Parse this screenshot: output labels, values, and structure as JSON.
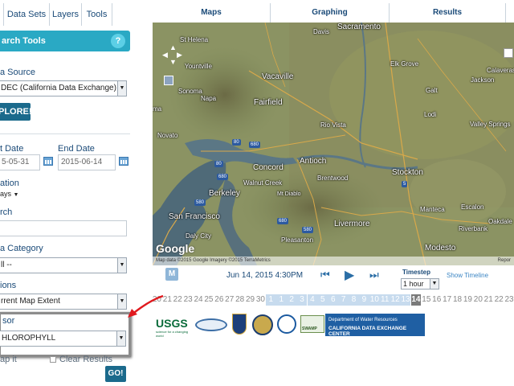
{
  "left_tabs": [
    "Data Sets",
    "Layers",
    "Tools"
  ],
  "search_header": {
    "title": "arch Tools",
    "help": "?"
  },
  "data_source": {
    "label": "a Source",
    "value": "DEC (California Data Exchange)"
  },
  "explore_button": "PLORE!",
  "dates": {
    "start_label": "t Date",
    "start_value": "5-05-31",
    "end_label": "End Date",
    "end_value": "2015-06-14"
  },
  "duration": {
    "label": "ation",
    "value": "ays"
  },
  "search": {
    "label": "rch",
    "value": ""
  },
  "data_category": {
    "label": "a Category",
    "value": "ll --"
  },
  "locations": {
    "label": "ions",
    "value": "rrent Map Extent"
  },
  "sensor": {
    "label": "sor",
    "value": "HLOROPHYLL"
  },
  "bottom_options": {
    "map_it": "ap it",
    "clear_results": "Clear Results"
  },
  "go_button": "GO!",
  "top_tabs": [
    "Maps",
    "Graphing",
    "Results"
  ],
  "map": {
    "labels": {
      "sacramento": "Sacramento",
      "davis": "Davis",
      "st_helena": "St Helena",
      "yountville": "Yountville",
      "vacaville": "Vacaville",
      "elk_grove": "Elk Grove",
      "sonoma": "Sonoma",
      "napa": "Napa",
      "fairfield": "Fairfield",
      "galt": "Galt",
      "lodi": "Lodi",
      "jackson": "Jackson",
      "novato": "Novato",
      "rio_vista": "Rio Vista",
      "valley_springs": "Valley Springs",
      "concord": "Concord",
      "antioch": "Antioch",
      "brentwood": "Brentwood",
      "stockton": "Stockton",
      "walnut_creek": "Walnut Creek",
      "mt_diablo": "Mt Diablo",
      "berkeley": "Berkeley",
      "san_francisco": "San Francisco",
      "daly_city": "Daly City",
      "livermore": "Livermore",
      "pleasanton": "Pleasanton",
      "manteca": "Manteca",
      "modesto": "Modesto",
      "oakdale": "Oakdale",
      "riverbank": "Riverbank",
      "escalon": "Escalon",
      "calaveras": "Calaveras",
      "corte_madera": "ma"
    },
    "attribution": "Map data ©2015 Google Imagery ©2015 TerraMetrics",
    "report": "Repor",
    "google": "Google"
  },
  "timeline": {
    "m_button": "M",
    "date_label": "Jun 14, 2015 4:30PM",
    "timestep_label": "Timestep",
    "timestep_value": "1 hour",
    "show_timeline": "Show Timeline",
    "days": [
      "20",
      "21",
      "22",
      "23",
      "24",
      "25",
      "26",
      "27",
      "28",
      "29",
      "30",
      "1",
      "1",
      "2",
      "3",
      "4",
      "5",
      "6",
      "7",
      "8",
      "9",
      "10",
      "11",
      "12",
      "13",
      "14",
      "15",
      "16",
      "17",
      "18",
      "19",
      "20",
      "21",
      "22",
      "23"
    ]
  },
  "logos": {
    "usgs": "USGS",
    "usgs_tagline": "science for a changing world",
    "dwr_line1": "Department of Water Resources",
    "dwr_line2": "CALIFORNIA DATA EXCHANGE CENTER",
    "swamp": "SWAMP"
  },
  "colors": {
    "accent": "#2aa9c4",
    "dark_button": "#1b6a8c",
    "text": "#1a4a78",
    "annotation_arrow": "#e0191e"
  }
}
